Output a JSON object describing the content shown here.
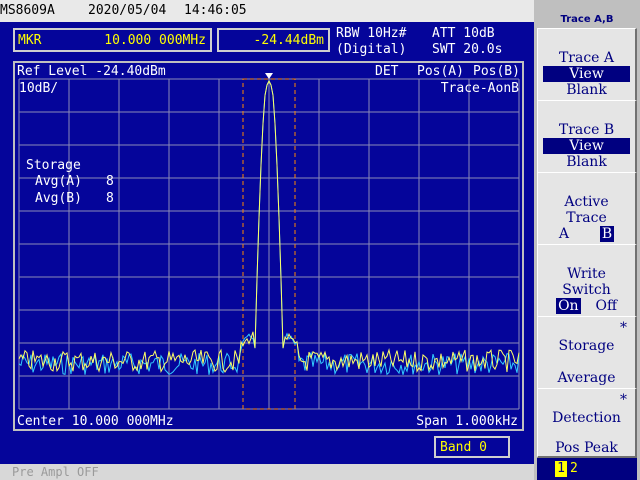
{
  "header": {
    "model": "MS8609A",
    "date": "2020/05/04",
    "time": "14:46:05",
    "rbw": "RBW 10Hz#",
    "rbw_mode": "(Digital)",
    "att": "ATT 10dB",
    "swt": "SWT 20.0s"
  },
  "marker": {
    "label": "MKR",
    "frequency": "10.000 000MHz",
    "level": "-24.44dBm"
  },
  "screen": {
    "ref_level": "Ref Level -24.40dBm",
    "scale": "10dB/",
    "det": "DET",
    "pos_a": "Pos(A)",
    "pos_b": "Pos(B)",
    "trace_mode": "Trace-AonB",
    "storage_title": "Storage",
    "avg_a_label": "Avg(A)",
    "avg_a_value": "8",
    "avg_b_label": "Avg(B)",
    "avg_b_value": "8",
    "center": "Center 10.000 000MHz",
    "span": "Span 1.000kHz"
  },
  "band": "Band 0",
  "pre_ampl": "Pre Ampl OFF",
  "softkeys": {
    "title": "Trace A,B",
    "trace_a": {
      "title": "Trace A",
      "opt1": "View",
      "opt2": "Blank"
    },
    "trace_b": {
      "title": "Trace B",
      "opt1": "View",
      "opt2": "Blank"
    },
    "active": {
      "line1": "Active",
      "line2": "Trace",
      "opt_a": "A",
      "opt_b": "B"
    },
    "write": {
      "line1": "Write",
      "line2": "Switch",
      "on": "On",
      "off": "Off"
    },
    "storage": {
      "mark": "*",
      "title": "Storage",
      "value": "Average"
    },
    "detection": {
      "mark": "*",
      "title": "Detection",
      "value": "Pos Peak"
    },
    "page_1": "1",
    "page_2": "2"
  },
  "colors": {
    "background": "#05059a",
    "grid": "#8a8ab8",
    "trace_a": "#ffff66",
    "trace_b": "#33ccff",
    "marker_window": "#ff8800"
  }
}
